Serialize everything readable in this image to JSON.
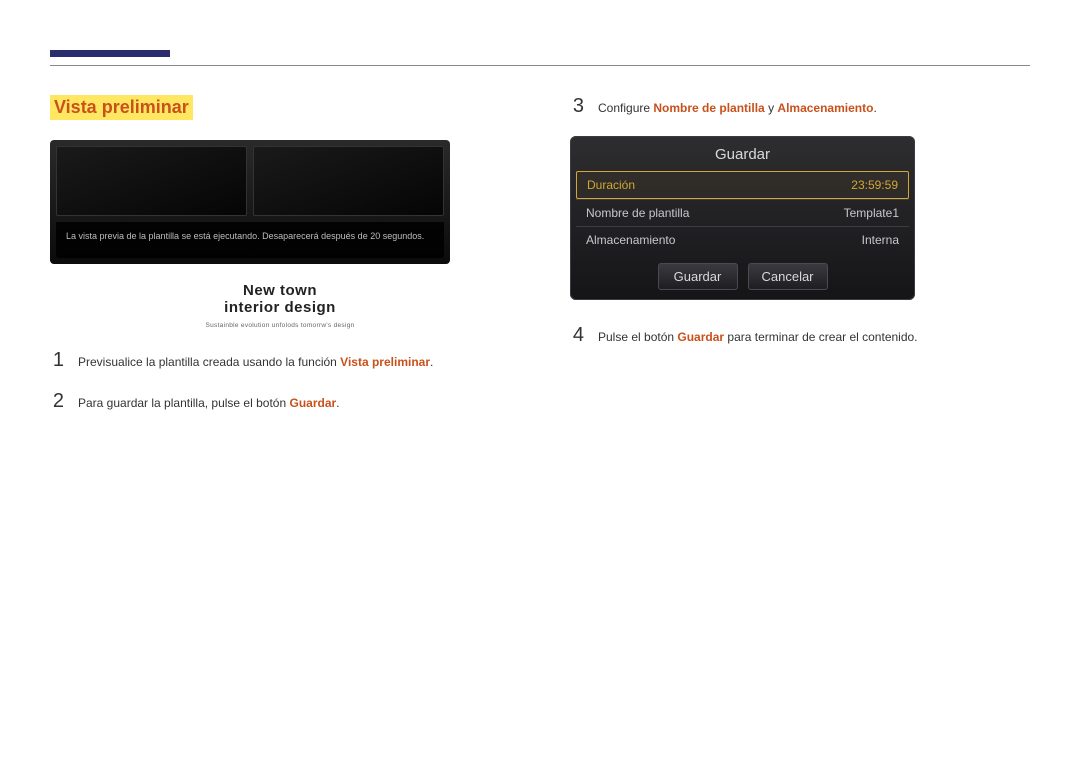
{
  "heading": "Vista preliminar",
  "preview": {
    "popup_msg": "La vista previa de la plantilla se está ejecutando. Desaparecerá después de 20 segundos.",
    "title_line1": "New town",
    "title_line2": "interior design",
    "subtitle": "Sustainble evolution unfolods tomorrw's design"
  },
  "steps": {
    "s1": {
      "num": "1",
      "pre": "Previsualice la plantilla creada usando la función ",
      "hl": "Vista preliminar",
      "post": "."
    },
    "s2": {
      "num": "2",
      "pre": "Para guardar la plantilla, pulse el botón ",
      "hl": "Guardar",
      "post": "."
    },
    "s3": {
      "num": "3",
      "pre": "Configure ",
      "hl1": "Nombre de plantilla",
      "mid": " y ",
      "hl2": "Almacenamiento",
      "post": "."
    },
    "s4": {
      "num": "4",
      "pre": "Pulse el botón ",
      "hl": "Guardar",
      "post": " para terminar de crear el contenido."
    }
  },
  "dialog": {
    "title": "Guardar",
    "rows": {
      "duracion": {
        "label": "Duración",
        "value": "23:59:59"
      },
      "nombre": {
        "label": "Nombre de plantilla",
        "value": "Template1"
      },
      "almac": {
        "label": "Almacenamiento",
        "value": "Interna"
      }
    },
    "buttons": {
      "save": "Guardar",
      "cancel": "Cancelar"
    }
  }
}
